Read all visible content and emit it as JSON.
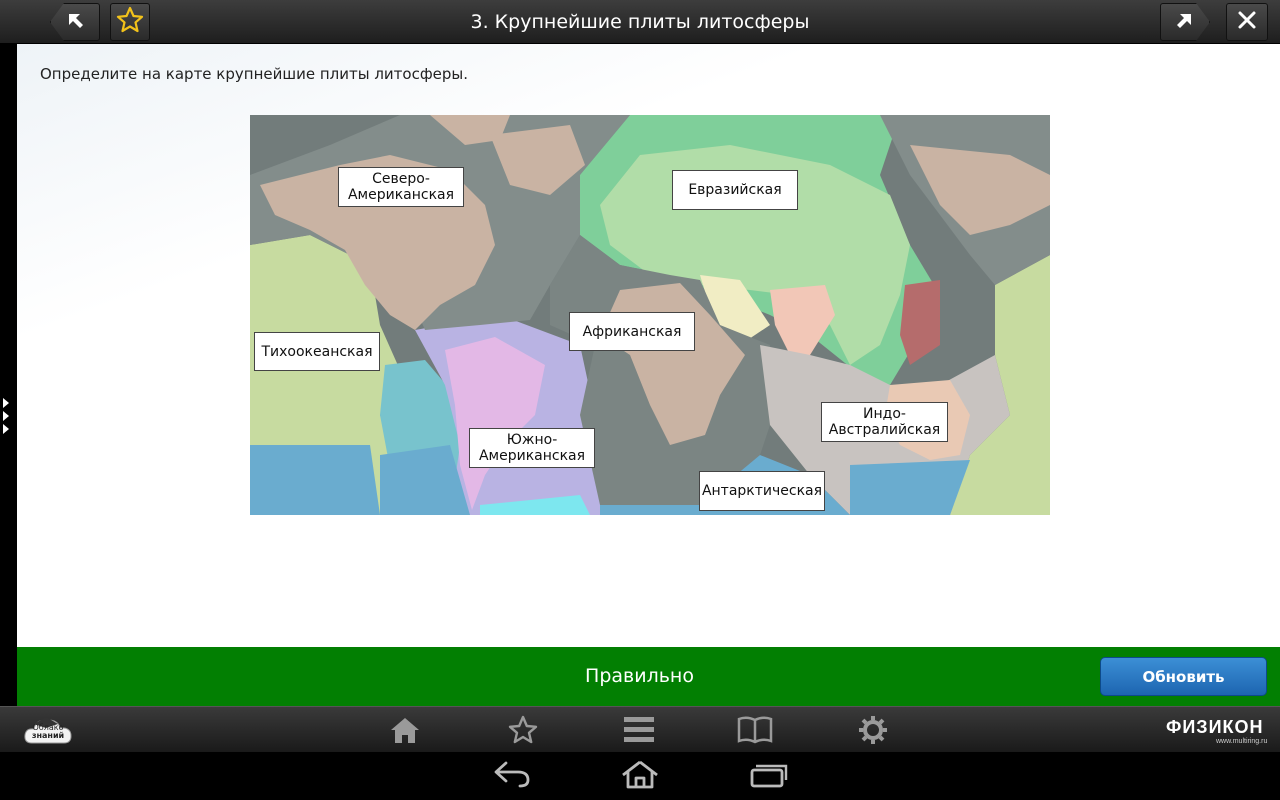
{
  "header": {
    "title": "3. Крупнейшие плиты литосферы",
    "back_icon": "arrow-up-left-icon",
    "favorite_icon": "star-icon",
    "forward_icon": "arrow-up-right-icon",
    "close_icon": "close-icon"
  },
  "task": {
    "instruction": "Определите на карте крупнейшие плиты литосферы."
  },
  "map": {
    "labels": [
      {
        "line1": "Северо-",
        "line2": "Американская"
      },
      {
        "line1": "Евразийская",
        "line2": ""
      },
      {
        "line1": "Тихоокеанская",
        "line2": ""
      },
      {
        "line1": "Африканская",
        "line2": ""
      },
      {
        "line1": "Южно-",
        "line2": "Американская"
      },
      {
        "line1": "Индо-",
        "line2": "Австралийская"
      },
      {
        "line1": "Антарктическая",
        "line2": ""
      }
    ],
    "colors": {
      "north_america": "#c9b3a3",
      "eurasia": "#7fcf9a",
      "pacific": "#c7dba0",
      "africa": "#7b8583",
      "south_america": "#b9b3e3",
      "indo_australia": "#c8c3c0",
      "antarctic_ocean": "#6aaccf"
    }
  },
  "feedback": {
    "status": "Правильно",
    "refresh_label": "Обновить",
    "status_color": "#027f02"
  },
  "bottom_bar": {
    "logo_text_line1": "Облако",
    "logo_text_line2": "знаний",
    "brand": "ФИЗИКОН",
    "brand_sub": "www.multiring.ru"
  }
}
